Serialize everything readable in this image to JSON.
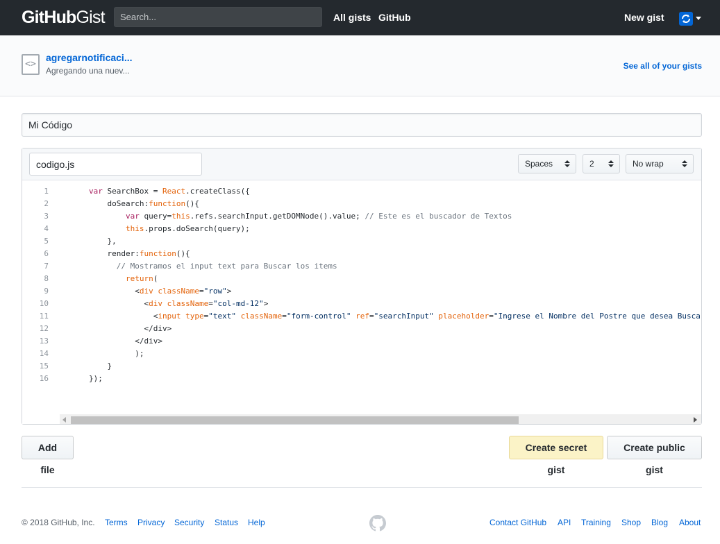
{
  "header": {
    "logo_bold": "GitHub",
    "logo_light": "Gist",
    "search_placeholder": "Search...",
    "nav": [
      "All gists",
      "GitHub"
    ],
    "new_gist": "New gist"
  },
  "subhead": {
    "gist_title": "agregarnotificaci...",
    "gist_desc": "Agregando una nuev...",
    "see_all": "See all of your gists"
  },
  "form": {
    "description_value": "Mi Código",
    "filename_value": "codigo.js",
    "indent_mode": "Spaces",
    "indent_size": "2",
    "wrap_mode": "No wrap"
  },
  "editor": {
    "line_numbers": [
      "1",
      "2",
      "3",
      "4",
      "5",
      "6",
      "7",
      "8",
      "9",
      "10",
      "11",
      "12",
      "13",
      "14",
      "15",
      "16"
    ],
    "lines": [
      [
        {
          "t": "kw",
          "v": "var"
        },
        {
          "t": "plain",
          "v": " SearchBox = "
        },
        {
          "t": "tag",
          "v": "React"
        },
        {
          "t": "plain",
          "v": ".createClass({"
        }
      ],
      [
        {
          "t": "plain",
          "v": "    doSearch:"
        },
        {
          "t": "tag",
          "v": "function"
        },
        {
          "t": "plain",
          "v": "(){"
        }
      ],
      [
        {
          "t": "plain",
          "v": "        "
        },
        {
          "t": "kw",
          "v": "var"
        },
        {
          "t": "plain",
          "v": " query="
        },
        {
          "t": "tag",
          "v": "this"
        },
        {
          "t": "plain",
          "v": ".refs.searchInput.getDOMNode().value; "
        },
        {
          "t": "cm",
          "v": "// Este es el buscador de Textos"
        }
      ],
      [
        {
          "t": "plain",
          "v": "        "
        },
        {
          "t": "tag",
          "v": "this"
        },
        {
          "t": "plain",
          "v": ".props.doSearch(query);"
        }
      ],
      [
        {
          "t": "plain",
          "v": "    },"
        }
      ],
      [
        {
          "t": "plain",
          "v": "    render:"
        },
        {
          "t": "tag",
          "v": "function"
        },
        {
          "t": "plain",
          "v": "(){"
        }
      ],
      [
        {
          "t": "plain",
          "v": "      "
        },
        {
          "t": "cm",
          "v": "// Mostramos el input text para Buscar los items"
        }
      ],
      [
        {
          "t": "plain",
          "v": "        "
        },
        {
          "t": "tag",
          "v": "return"
        },
        {
          "t": "plain",
          "v": "("
        }
      ],
      [
        {
          "t": "plain",
          "v": "          <"
        },
        {
          "t": "tag",
          "v": "div"
        },
        {
          "t": "plain",
          "v": " "
        },
        {
          "t": "tag",
          "v": "className"
        },
        {
          "t": "plain",
          "v": "="
        },
        {
          "t": "str",
          "v": "\"row\""
        },
        {
          "t": "plain",
          "v": ">"
        }
      ],
      [
        {
          "t": "plain",
          "v": "            <"
        },
        {
          "t": "tag",
          "v": "div"
        },
        {
          "t": "plain",
          "v": " "
        },
        {
          "t": "tag",
          "v": "className"
        },
        {
          "t": "plain",
          "v": "="
        },
        {
          "t": "str",
          "v": "\"col-md-12\""
        },
        {
          "t": "plain",
          "v": ">"
        }
      ],
      [
        {
          "t": "plain",
          "v": "              <"
        },
        {
          "t": "tag",
          "v": "input"
        },
        {
          "t": "plain",
          "v": " "
        },
        {
          "t": "tag",
          "v": "type"
        },
        {
          "t": "plain",
          "v": "="
        },
        {
          "t": "str",
          "v": "\"text\""
        },
        {
          "t": "plain",
          "v": " "
        },
        {
          "t": "tag",
          "v": "className"
        },
        {
          "t": "plain",
          "v": "="
        },
        {
          "t": "str",
          "v": "\"form-control\""
        },
        {
          "t": "plain",
          "v": " "
        },
        {
          "t": "tag",
          "v": "ref"
        },
        {
          "t": "plain",
          "v": "="
        },
        {
          "t": "str",
          "v": "\"searchInput\""
        },
        {
          "t": "plain",
          "v": " "
        },
        {
          "t": "tag",
          "v": "placeholder"
        },
        {
          "t": "plain",
          "v": "="
        },
        {
          "t": "str",
          "v": "\"Ingrese el Nombre del Postre que desea Buscar"
        }
      ],
      [
        {
          "t": "plain",
          "v": "            </div>"
        }
      ],
      [
        {
          "t": "plain",
          "v": "          </div>"
        }
      ],
      [
        {
          "t": "plain",
          "v": "          );"
        }
      ],
      [
        {
          "t": "plain",
          "v": "    }"
        }
      ],
      [
        {
          "t": "plain",
          "v": "});"
        }
      ]
    ]
  },
  "actions": {
    "add_file": "Add file",
    "create_secret": "Create secret gist",
    "create_public": "Create public gist"
  },
  "footer": {
    "copyright": "© 2018 GitHub, Inc.",
    "left_links": [
      "Terms",
      "Privacy",
      "Security",
      "Status",
      "Help"
    ],
    "right_links": [
      "Contact GitHub",
      "API",
      "Training",
      "Shop",
      "Blog",
      "About"
    ]
  },
  "colors": {
    "header_bg": "#24292e",
    "link": "#0366d6",
    "secret_btn_bg": "#fbf3c7",
    "keyword": "#a71d5d",
    "attr_orange": "#e36209",
    "string": "#032f62",
    "comment": "#6a737d"
  },
  "icons": [
    "code-file-icon",
    "avatar-icon",
    "caret-down-icon",
    "github-octocat-icon"
  ]
}
